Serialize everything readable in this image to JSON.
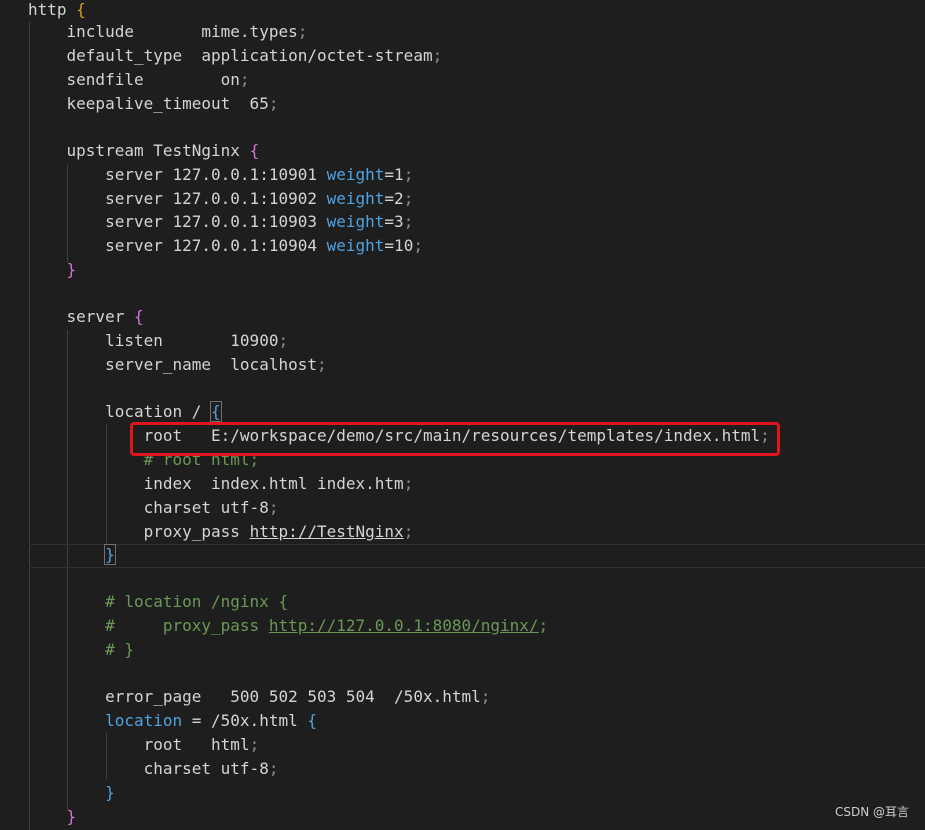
{
  "code": {
    "l01": {
      "a": "http",
      "b": " {"
    },
    "l02": {
      "a": "    include       mime.types",
      "b": ";"
    },
    "l03": {
      "a": "    default_type  application/octet-stream",
      "b": ";"
    },
    "l04": {
      "a": "    sendfile        on",
      "b": ";"
    },
    "l05": {
      "a": "    keepalive_timeout  65",
      "b": ";"
    },
    "l07": {
      "a": "    upstream TestNginx ",
      "b": "{"
    },
    "l08": {
      "a": "        server 127.0.0.1:10901 ",
      "kw": "weight",
      "c": "=1",
      "d": ";"
    },
    "l09": {
      "a": "        server 127.0.0.1:10902 ",
      "kw": "weight",
      "c": "=2",
      "d": ";"
    },
    "l10": {
      "a": "        server 127.0.0.1:10903 ",
      "kw": "weight",
      "c": "=3",
      "d": ";"
    },
    "l11": {
      "a": "        server 127.0.0.1:10904 ",
      "kw": "weight",
      "c": "=10",
      "d": ";"
    },
    "l12": {
      "a": "    ",
      "b": "}"
    },
    "l14": {
      "a": "    server ",
      "b": "{"
    },
    "l15": {
      "a": "        listen       10900",
      "b": ";"
    },
    "l16": {
      "a": "        server_name  localhost",
      "b": ";"
    },
    "l18": {
      "a": "        location / ",
      "b": "{"
    },
    "l19": {
      "a": "            root   E:/workspace/demo/src/main/resources/templates/index.html",
      "b": ";"
    },
    "l20": {
      "a": "            ",
      "cm": "# root html;"
    },
    "l21": {
      "a": "            index  index.html index.htm",
      "b": ";"
    },
    "l22": {
      "a": "            charset utf-8",
      "b": ";"
    },
    "l23": {
      "a": "            proxy_pass ",
      "link": "http://TestNginx",
      "b": ";"
    },
    "l24": {
      "a": "        ",
      "b": "}"
    },
    "l26": {
      "a": "        ",
      "cm": "# location /nginx {"
    },
    "l27": {
      "a": "        ",
      "cm1": "#     proxy_pass ",
      "link": "http://127.0.0.1:8080/nginx/",
      "cm2": ";"
    },
    "l28": {
      "a": "        ",
      "cm": "# }"
    },
    "l30": {
      "a": "        error_page   500 502 503 504  /50x.html",
      "b": ";"
    },
    "l31": {
      "a": "        ",
      "kw": "location",
      "c": " = /50x.html ",
      "br": "{"
    },
    "l32": {
      "a": "            root   html",
      "b": ";"
    },
    "l33": {
      "a": "            charset utf-8",
      "b": ";"
    },
    "l34": {
      "a": "        ",
      "b": "}"
    },
    "l35": {
      "a": "    ",
      "b": "}"
    }
  },
  "watermark": "CSDN @耳言",
  "colors": {
    "background": "#1e1e1e",
    "text": "#d4d4d4",
    "keyword": "#4fa3e0",
    "comment": "#6a9955",
    "brace_outer": "#d4a017",
    "brace_inner": "#da70d6",
    "highlight_box": "#e0141e"
  }
}
